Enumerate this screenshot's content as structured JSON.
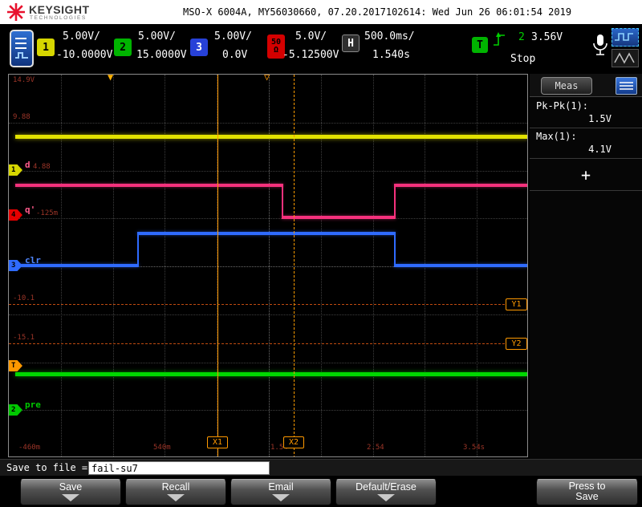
{
  "header": {
    "brand": "KEYSIGHT",
    "brand_sub": "TECHNOLOGIES",
    "title": "MSO-X 6004A, MY56030660, 07.20.2017102614: Wed Jun 26 06:01:54 2019"
  },
  "channel_bar": {
    "channels": [
      {
        "num": "1",
        "scale": "5.00V/",
        "offset": "-10.0000V"
      },
      {
        "num": "2",
        "scale": "5.00V/",
        "offset": "15.0000V"
      },
      {
        "num": "3",
        "scale": "5.00V/",
        "offset": "0.0V"
      },
      {
        "num": "50",
        "sub": "Ω",
        "scale": "5.0V/",
        "offset": "-5.12500V"
      }
    ],
    "horizontal": {
      "label": "H",
      "scale": "500.0ms/",
      "delay": "1.540s"
    },
    "trigger": {
      "label": "T",
      "source": "2",
      "level": "3.56V",
      "mode": "Stop"
    }
  },
  "plot": {
    "top_markers": {
      "trigger": "▼",
      "delay": "▽"
    },
    "left_markers": [
      "1",
      "4",
      "3",
      "T",
      "2"
    ],
    "signal_labels": {
      "d": "d",
      "q": "q'",
      "clr": "clr",
      "pre": "pre"
    },
    "y_labels": [
      "14.9V",
      "9.88",
      "4.88",
      "-125m",
      "-10.1",
      "-15.1"
    ],
    "x_labels": [
      "-460m",
      "540m",
      "1.54",
      "2.54",
      "3.54s"
    ],
    "cursor_flags": {
      "x1": "X1",
      "x2": "X2",
      "y1": "Y1",
      "y2": "Y2"
    }
  },
  "meas_panel": {
    "title": "Meas",
    "items": [
      {
        "name": "Pk-Pk(1):",
        "value": "1.5V"
      },
      {
        "name": "Max(1):",
        "value": "4.1V"
      }
    ],
    "add_label": "+"
  },
  "save_bar": {
    "label": "Save to file = ",
    "filename": "fail-su7"
  },
  "softkeys": [
    {
      "label": "Save"
    },
    {
      "label": "Recall"
    },
    {
      "label": "Email"
    },
    {
      "label": "Default/Erase"
    },
    {
      "label": "Press to",
      "label2": "Save"
    }
  ],
  "colors": {
    "ch1": "#e2e200",
    "ch2": "#00d800",
    "ch3": "#2f6bff",
    "ch4": "#f5317c",
    "cursor": "#ff9900",
    "keysight_red": "#e8112d"
  }
}
